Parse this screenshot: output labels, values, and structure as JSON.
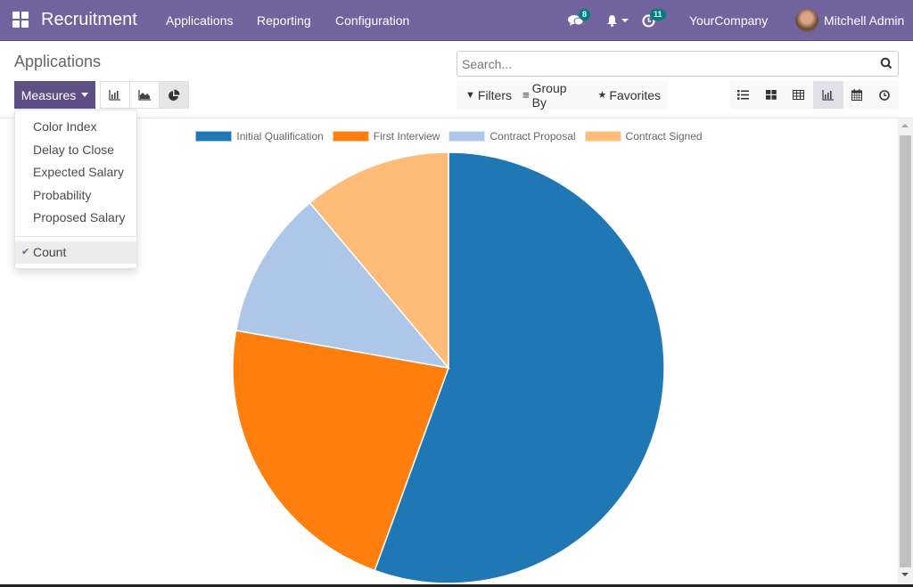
{
  "navbar": {
    "app_name": "Recruitment",
    "menus": [
      "Applications",
      "Reporting",
      "Configuration"
    ],
    "messages_badge": "8",
    "activities_badge": "11",
    "company": "YourCompany",
    "user": "Mitchell Admin",
    "icons": {
      "apps": "apps-grid-icon",
      "messages": "chat-bubbles-icon",
      "notifications": "bell-icon",
      "activities": "clock-icon"
    },
    "color": "#71639e"
  },
  "control_panel": {
    "title": "Applications",
    "measures_label": "Measures",
    "chart_modes": [
      {
        "name": "bar",
        "icon": "bar-chart-icon",
        "active": false
      },
      {
        "name": "line",
        "icon": "area-chart-icon",
        "active": false
      },
      {
        "name": "pie",
        "icon": "pie-chart-icon",
        "active": true
      }
    ],
    "search": {
      "placeholder": "Search...",
      "value": ""
    },
    "filters_label": "Filters",
    "groupby_label": "Group By",
    "favorites_label": "Favorites",
    "views": [
      {
        "name": "list",
        "icon": "list-icon",
        "active": false
      },
      {
        "name": "kanban",
        "icon": "kanban-icon",
        "active": false
      },
      {
        "name": "pivot",
        "icon": "table-icon",
        "active": false
      },
      {
        "name": "graph",
        "icon": "bar-chart-icon",
        "active": true
      },
      {
        "name": "calendar",
        "icon": "calendar-icon",
        "active": false
      },
      {
        "name": "activity",
        "icon": "clock-icon",
        "active": false
      }
    ]
  },
  "measures_dropdown": {
    "items": [
      "Color Index",
      "Delay to Close",
      "Expected Salary",
      "Probability",
      "Proposed Salary"
    ],
    "selected": "Count"
  },
  "chart_data": {
    "type": "pie",
    "title": "",
    "measure": "Count",
    "legend_position": "top",
    "categories": [
      "Initial Qualification",
      "First Interview",
      "Contract Proposal",
      "Contract Signed"
    ],
    "values": [
      5,
      2,
      1,
      1
    ],
    "colors": [
      "#1f77b4",
      "#ff7f0e",
      "#aec7e8",
      "#ffbb78"
    ]
  }
}
